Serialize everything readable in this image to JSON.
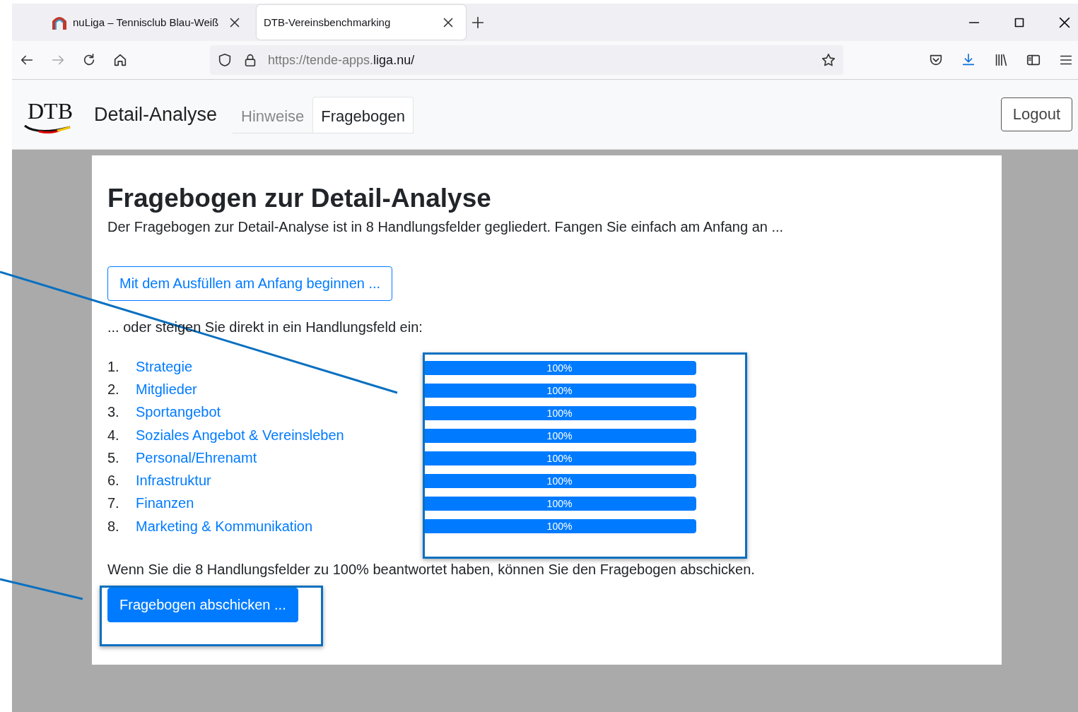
{
  "browser": {
    "tabs": [
      {
        "title": "nuLiga – Tennisclub Blau-Weiß",
        "selected": false
      },
      {
        "title": "DTB-Vereinsbenchmarking",
        "selected": true
      }
    ],
    "address": {
      "prefix": "https://tende-apps.",
      "host": "liga.nu/"
    }
  },
  "header": {
    "logo": "DTB",
    "title": "Detail-Analyse",
    "nav": [
      {
        "label": "Hinweise",
        "selected": false
      },
      {
        "label": "Fragebogen",
        "selected": true
      }
    ],
    "logout": "Logout"
  },
  "main": {
    "heading": "Fragebogen zur Detail-Analyse",
    "intro": "Der Fragebogen zur Detail-Analyse ist in 8 Handlungsfelder gegliedert. Fangen Sie einfach am Anfang an ...",
    "start_button": "Mit dem Ausfüllen am Anfang beginnen ...",
    "or_text": "... oder steigen Sie direkt in ein Handlungsfeld ein:",
    "fields": [
      {
        "number": "1.",
        "label": "Strategie",
        "level": 1,
        "reading": "100%"
      },
      {
        "number": "2.",
        "label": "Mitglieder",
        "level": 1,
        "reading": "100%"
      },
      {
        "number": "3.",
        "label": "Sportangebot",
        "level": 1,
        "reading": "100%"
      },
      {
        "number": "4.",
        "label": "Soziales Angebot & Vereinsleben",
        "level": 1,
        "reading": "100%"
      },
      {
        "number": "5.",
        "label": "Personal/Ehrenamt",
        "level": 1,
        "reading": "100%"
      },
      {
        "number": "6.",
        "label": "Infrastruktur",
        "level": 1,
        "reading": "100%"
      },
      {
        "number": "7.",
        "label": "Finanzen",
        "level": 1,
        "reading": "100%"
      },
      {
        "number": "8.",
        "label": "Marketing & Kommunikation",
        "level": 1,
        "reading": "100%"
      }
    ],
    "note": "Wenn Sie die 8 Handlungsfelder zu 100% beantwortet haben, können Sie den Fragebogen abschicken.",
    "submit_button": "Fragebogen abschicken ..."
  }
}
